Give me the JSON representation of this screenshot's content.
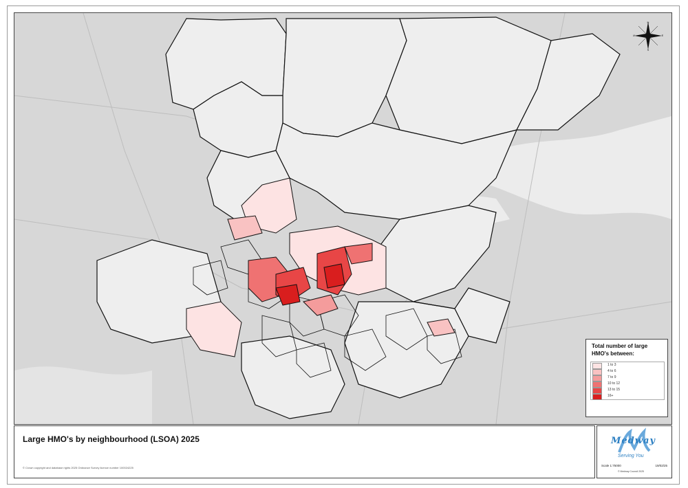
{
  "map": {
    "title": "Large HMO's by neighbourhood (LSOA) 2025",
    "copyright": "© Crown copyright and database rights 2025 Ordnance Survey licence number 100024225",
    "background_color": "#d9d9d9",
    "water_color": "#eeeeee"
  },
  "legend": {
    "title": "Total number of large HMO's between:",
    "items": [
      {
        "label": "1 to 3",
        "color": "#fde3e3"
      },
      {
        "label": "4 to 6",
        "color": "#f9c2c2"
      },
      {
        "label": "7 to 9",
        "color": "#f49c9c"
      },
      {
        "label": "10 to 12",
        "color": "#ef7272"
      },
      {
        "label": "13 to 15",
        "color": "#e84646"
      },
      {
        "label": "16+",
        "color": "#d91e1e"
      }
    ]
  },
  "compass": {
    "north": "N",
    "south": "S",
    "east": "E",
    "west": "W"
  },
  "logo": {
    "name": "Medway",
    "tagline": "Serving You",
    "scale": "Scale 1:75000",
    "date": "19/02/25",
    "council": "© Medway Council 2025"
  }
}
